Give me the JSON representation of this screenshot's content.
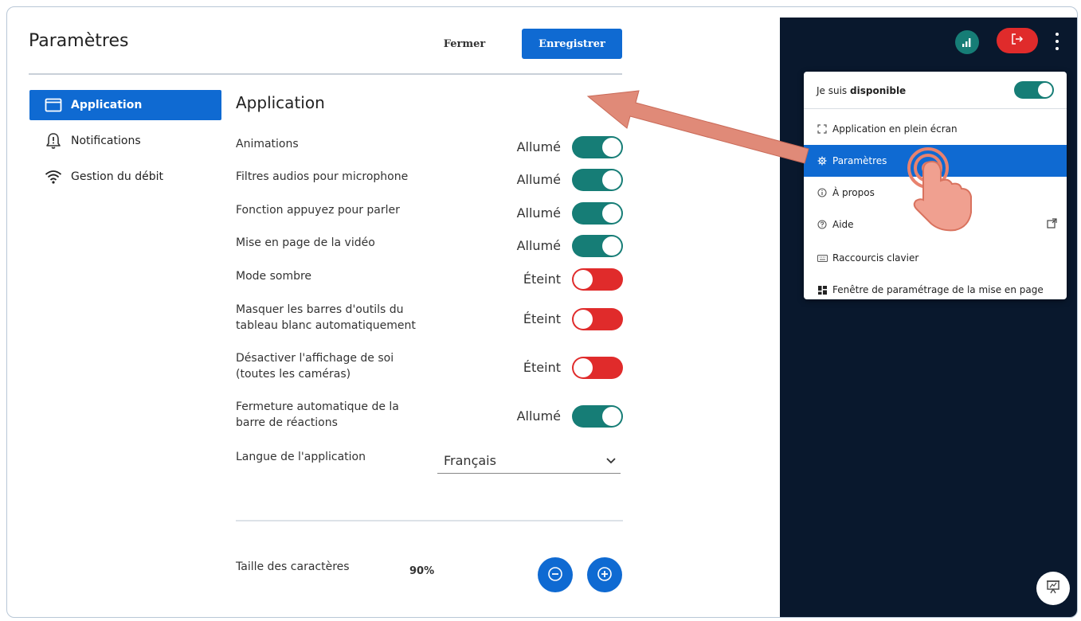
{
  "settings": {
    "title": "Paramètres",
    "close_label": "Fermer",
    "save_label": "Enregistrer",
    "nav": [
      {
        "label": "Application",
        "icon": "window-icon",
        "active": true
      },
      {
        "label": "Notifications",
        "icon": "bell-alert-icon",
        "active": false
      },
      {
        "label": "Gestion du débit",
        "icon": "wifi-icon",
        "active": false
      }
    ],
    "section_title": "Application",
    "rows": [
      {
        "label": "Animations",
        "state": "Allumé",
        "on": true
      },
      {
        "label": "Filtres audios pour microphone",
        "state": "Allumé",
        "on": true
      },
      {
        "label": "Fonction appuyez pour parler",
        "state": "Allumé",
        "on": true
      },
      {
        "label": "Mise en page de la vidéo",
        "state": "Allumé",
        "on": true
      },
      {
        "label": "Mode sombre",
        "state": "Éteint",
        "on": false
      },
      {
        "label": "Masquer les barres d'outils du tableau blanc automatiquement",
        "line1": "Masquer les barres d'outils du",
        "line2": "tableau blanc automatiquement",
        "state": "Éteint",
        "on": false
      },
      {
        "label": "Désactiver l'affichage de soi (toutes les caméras)",
        "line1": "Désactiver l'affichage de soi",
        "line2": "(toutes les caméras)",
        "state": "Éteint",
        "on": false
      },
      {
        "label": "Fermeture automatique de la barre de réactions",
        "line1": "Fermeture automatique de la",
        "line2": "barre de réactions",
        "state": "Allumé",
        "on": true
      }
    ],
    "language_label": "Langue de l'application",
    "language_value": "Français",
    "font_size_label": "Taille des caractères",
    "font_size_value": "90%"
  },
  "menu": {
    "status_prefix": "Je suis",
    "status_value": "disponible",
    "items": [
      {
        "label": "Application en plein écran",
        "icon": "fullscreen-icon"
      },
      {
        "label": "Paramètres",
        "icon": "gear-icon",
        "active": true
      },
      {
        "label": "À propos",
        "icon": "info-icon"
      },
      {
        "label": "Aide",
        "icon": "help-icon",
        "external": true
      },
      {
        "label": "Raccourcis clavier",
        "icon": "keyboard-icon"
      },
      {
        "label": "Fenêtre de paramétrage de la mise en page",
        "icon": "layout-icon"
      }
    ]
  },
  "colors": {
    "primary": "#0f6ad2",
    "toggle_on": "#167d76",
    "toggle_off": "#e02b2b",
    "dark_panel": "#09182d",
    "arrow": "#e08a78"
  }
}
